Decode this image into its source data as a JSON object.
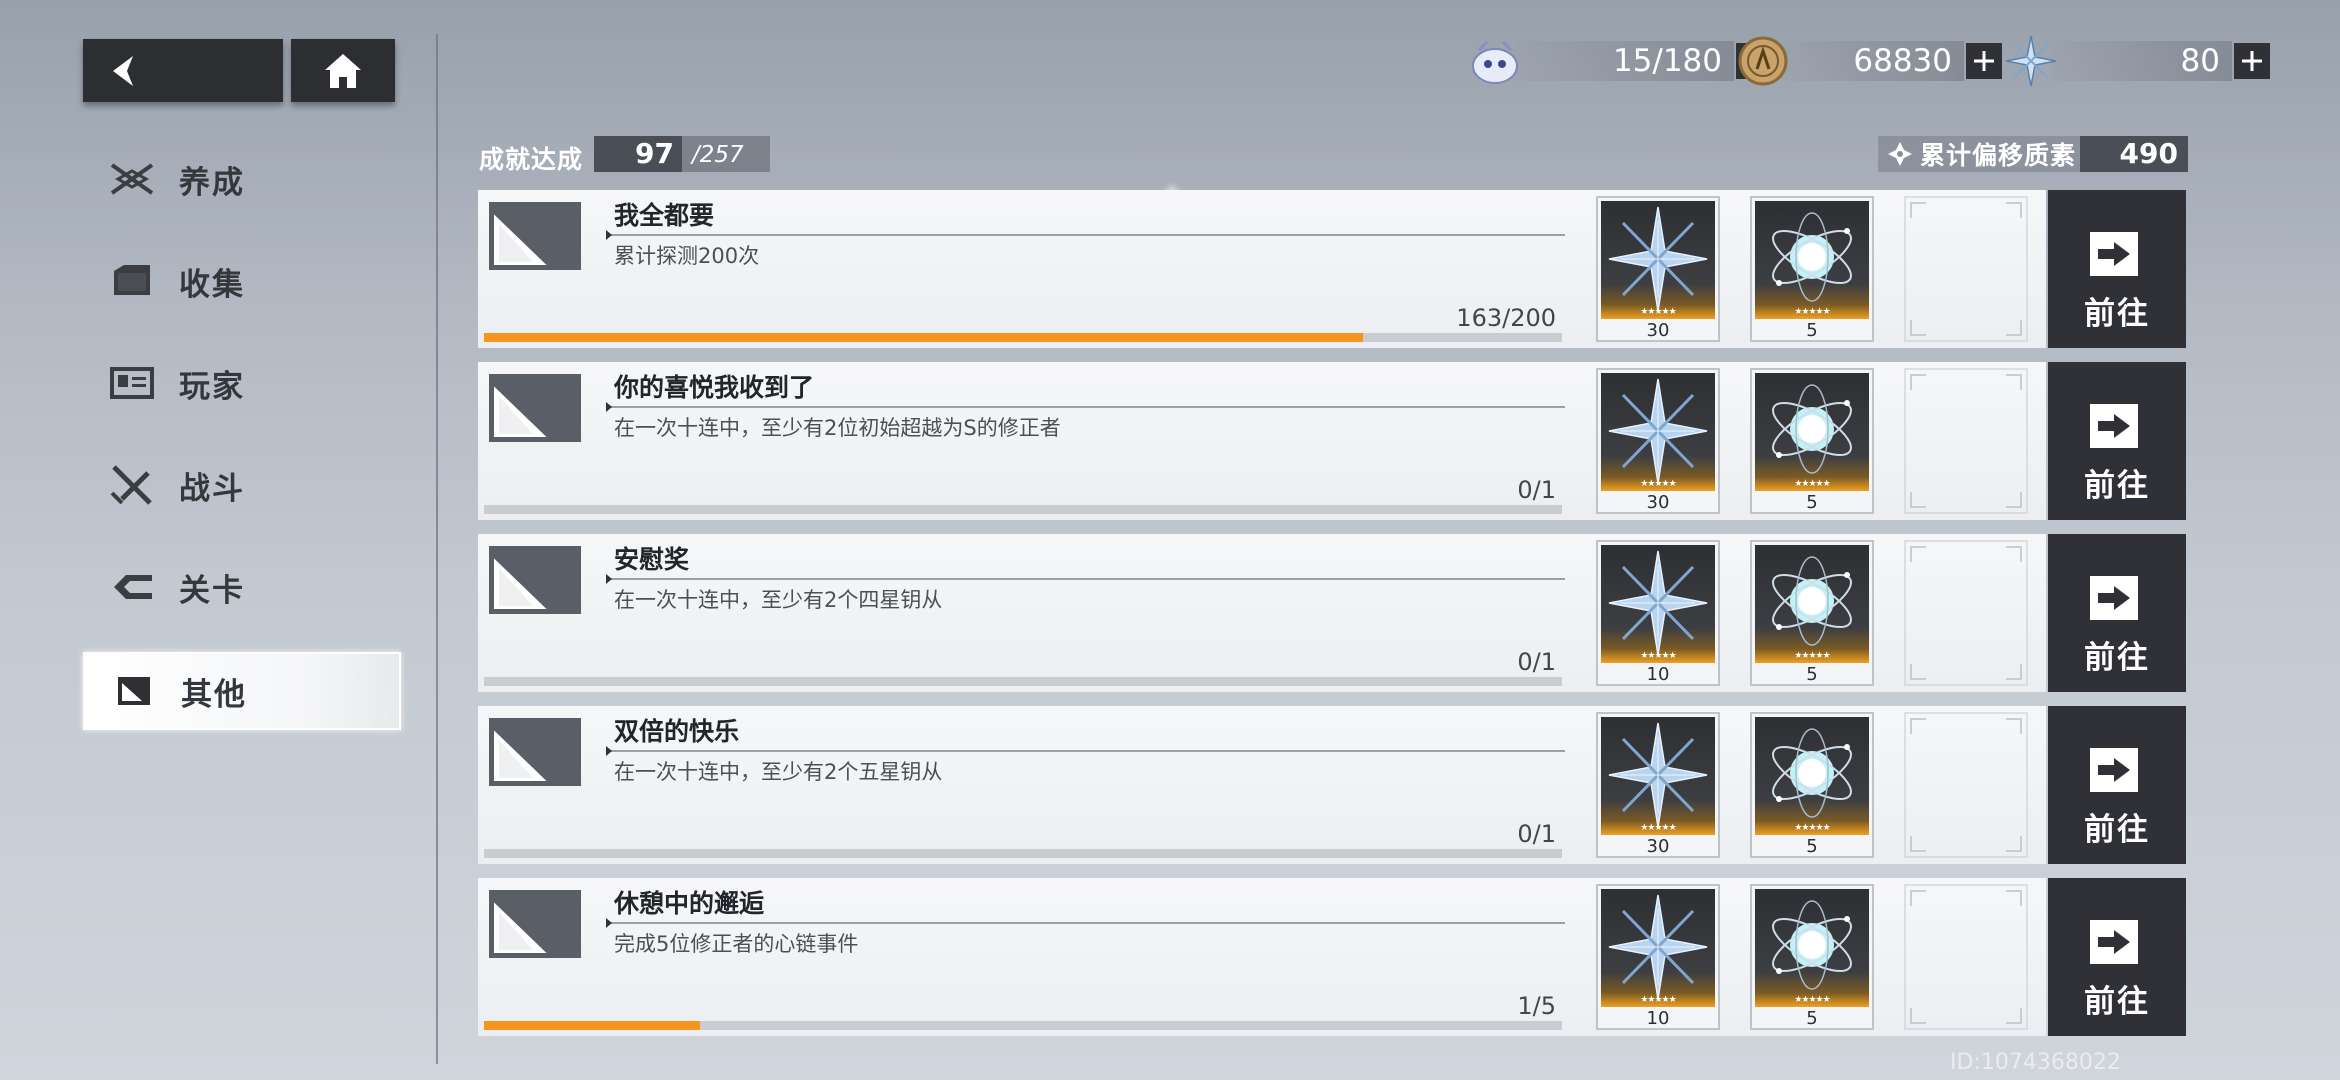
{
  "nav": {
    "back_icon": "back-arrow-icon",
    "home_icon": "home-icon"
  },
  "currencies": [
    {
      "icon": "stamina-icon",
      "value": "15/180"
    },
    {
      "icon": "coin-icon",
      "value": "68830"
    },
    {
      "icon": "crystal-icon",
      "value": "80"
    }
  ],
  "sidebar": {
    "items": [
      {
        "label": "养成",
        "icon": "cultivate-icon"
      },
      {
        "label": "收集",
        "icon": "collection-icon"
      },
      {
        "label": "玩家",
        "icon": "player-icon"
      },
      {
        "label": "战斗",
        "icon": "battle-icon"
      },
      {
        "label": "关卡",
        "icon": "stage-icon"
      },
      {
        "label": "其他",
        "icon": "other-icon",
        "active": true
      }
    ]
  },
  "header": {
    "achievement_label": "成就达成",
    "achievement_current": "97",
    "achievement_total": "/257",
    "offset_label": "累计偏移质素",
    "offset_value": "490"
  },
  "achievements": [
    {
      "title": "我全都要",
      "desc": "累计探测200次",
      "progress": "163/200",
      "fraction": 0.815,
      "rewards": [
        {
          "icon": "crystal-reward-icon",
          "count": "30"
        },
        {
          "icon": "orb-reward-icon",
          "count": "5"
        }
      ],
      "goto": "前往"
    },
    {
      "title": "你的喜悦我收到了",
      "desc": "在一次十连中，至少有2位初始超越为S的修正者",
      "progress": "0/1",
      "fraction": 0,
      "rewards": [
        {
          "icon": "crystal-reward-icon",
          "count": "30"
        },
        {
          "icon": "orb-reward-icon",
          "count": "5"
        }
      ],
      "goto": "前往"
    },
    {
      "title": "安慰奖",
      "desc": "在一次十连中，至少有2个四星钥从",
      "progress": "0/1",
      "fraction": 0,
      "rewards": [
        {
          "icon": "crystal-reward-icon",
          "count": "10"
        },
        {
          "icon": "orb-reward-icon",
          "count": "5"
        }
      ],
      "goto": "前往"
    },
    {
      "title": "双倍的快乐",
      "desc": "在一次十连中，至少有2个五星钥从",
      "progress": "0/1",
      "fraction": 0,
      "rewards": [
        {
          "icon": "crystal-reward-icon",
          "count": "30"
        },
        {
          "icon": "orb-reward-icon",
          "count": "5"
        }
      ],
      "goto": "前往"
    },
    {
      "title": "休憩中的邂逅",
      "desc": "完成5位修正者的心链事件",
      "progress": "1/5",
      "fraction": 0.2,
      "rewards": [
        {
          "icon": "crystal-reward-icon",
          "count": "10"
        },
        {
          "icon": "orb-reward-icon",
          "count": "5"
        }
      ],
      "goto": "前往"
    }
  ],
  "watermark": "ID:1074368022",
  "colors": {
    "progress": "#f7941d",
    "dark_button": "#2f3136"
  }
}
